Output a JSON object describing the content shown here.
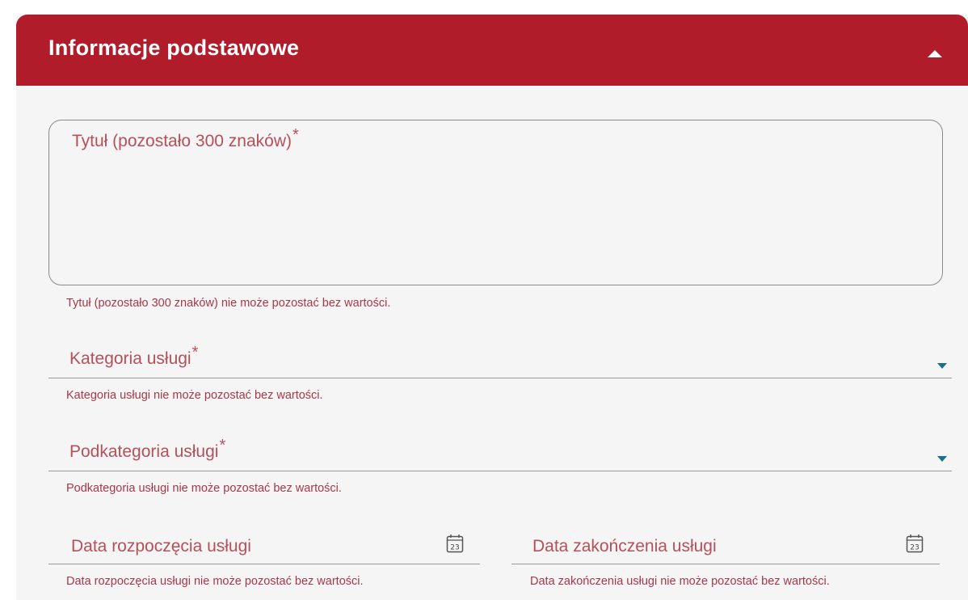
{
  "section": {
    "title": "Informacje podstawowe",
    "collapse_icon": "caret-up-icon"
  },
  "title_field": {
    "label": "Tytuł (pozostało 300 znaków)",
    "required_mark": "*",
    "value": "",
    "error": "Tytuł (pozostało 300 znaków) nie może pozostać bez wartości."
  },
  "category_field": {
    "label": "Kategoria usługi",
    "required_mark": "*",
    "error": "Kategoria usługi nie może pozostać bez wartości.",
    "icon": "caret-down-icon"
  },
  "subcategory_field": {
    "label": "Podkategoria usługi",
    "required_mark": "*",
    "error": "Podkategoria usługi nie może pozostać bez wartości.",
    "icon": "caret-down-icon"
  },
  "start_date_field": {
    "label": "Data rozpoczęcia usługi",
    "error": "Data rozpoczęcia usługi nie może pozostać bez wartości.",
    "icon": "calendar-icon",
    "icon_day": "23"
  },
  "end_date_field": {
    "label": "Data zakończenia usługi",
    "error": "Data zakończenia usługi nie może pozostać bez wartości.",
    "icon": "calendar-icon",
    "icon_day": "23"
  },
  "colors": {
    "header_bg": "#b01c2a",
    "label": "#b5505b",
    "error": "#a8374a",
    "caret": "#1a6f8a",
    "panel_bg": "#f5f5f5"
  }
}
